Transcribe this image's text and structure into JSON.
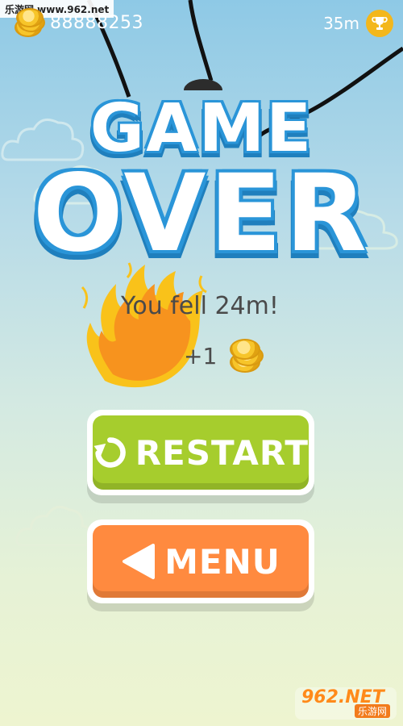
{
  "watermark_top": "乐游网 www.962.net",
  "hud": {
    "coins": "88888253",
    "distance": "35m",
    "coin_icon": "coin-stack-icon",
    "trophy_icon": "trophy-icon"
  },
  "title": {
    "line1": "GAME",
    "line2": "OVER"
  },
  "result": {
    "fell": "You fell 24m!",
    "reward": "+1"
  },
  "buttons": {
    "restart": {
      "label": "RESTART",
      "icon": "restart-arrow-icon",
      "color": "#a6cd2d"
    },
    "menu": {
      "label": "MENU",
      "icon": "back-triangle-icon",
      "color": "#ff8a3f"
    }
  },
  "watermark_bottom": {
    "brand": "962.NET",
    "sub": "乐游网"
  },
  "colors": {
    "title_outline": "#2a95d8",
    "sky_top": "#8ec9e6",
    "sky_bottom": "#eef4d0",
    "fire": "#f7931e"
  }
}
